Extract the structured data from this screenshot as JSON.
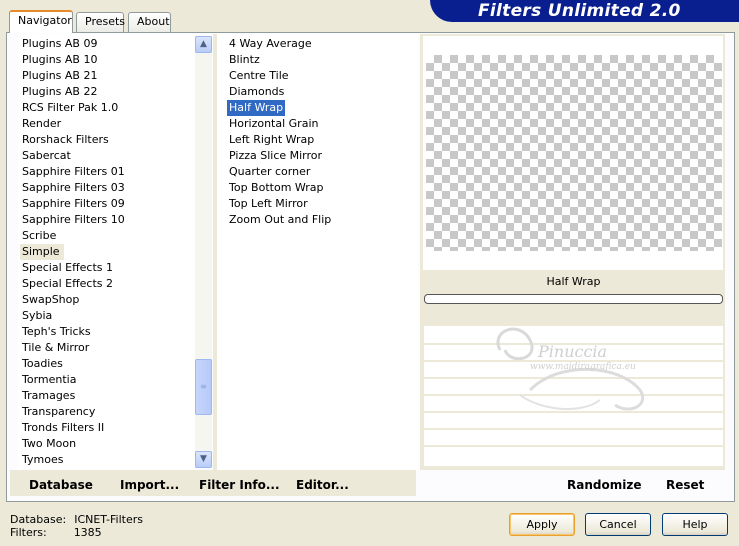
{
  "tabs": [
    {
      "label": "Navigator"
    },
    {
      "label": "Presets"
    },
    {
      "label": "About"
    }
  ],
  "app_title": "Filters Unlimited 2.0",
  "categories": [
    "Plugins AB 09",
    "Plugins AB 10",
    "Plugins AB 21",
    "Plugins AB 22",
    "RCS Filter Pak 1.0",
    "Render",
    "Rorshack Filters",
    "Sabercat",
    "Sapphire Filters 01",
    "Sapphire Filters 03",
    "Sapphire Filters 09",
    "Sapphire Filters 10",
    "Scribe",
    "Simple",
    "Special Effects 1",
    "Special Effects 2",
    "SwapShop",
    "Sybia",
    "Teph's Tricks",
    "Tile & Mirror",
    "Toadies",
    "Tormentia",
    "Tramages",
    "Transparency",
    "Tronds Filters II",
    "Two Moon",
    "Tymoes"
  ],
  "selected_category": "Simple",
  "filters": [
    "4 Way Average",
    "Blintz",
    "Centre Tile",
    "Diamonds",
    "Half Wrap",
    "Horizontal Grain",
    "Left Right Wrap",
    "Pizza Slice Mirror",
    "Quarter corner",
    "Top Bottom Wrap",
    "Top Left Mirror",
    "Zoom Out and Flip"
  ],
  "selected_filter": "Half Wrap",
  "preview_filter_name": "Half Wrap",
  "watermark": {
    "name": "Pinuccia",
    "site": "www.maidiragrafica.eu"
  },
  "bottom_links": {
    "database": "Database",
    "import": "Import...",
    "filter_info": "Filter Info...",
    "editor": "Editor...",
    "randomize": "Randomize",
    "reset": "Reset"
  },
  "status": {
    "database_label": "Database:",
    "database_value": "ICNET-Filters",
    "filters_label": "Filters:",
    "filters_value": "1385"
  },
  "buttons": {
    "apply": "Apply",
    "cancel": "Cancel",
    "help": "Help"
  },
  "colors": {
    "title_banner": "#0a1f8f",
    "selection": "#316ac5",
    "dialog_bg": "#ece9d8"
  }
}
